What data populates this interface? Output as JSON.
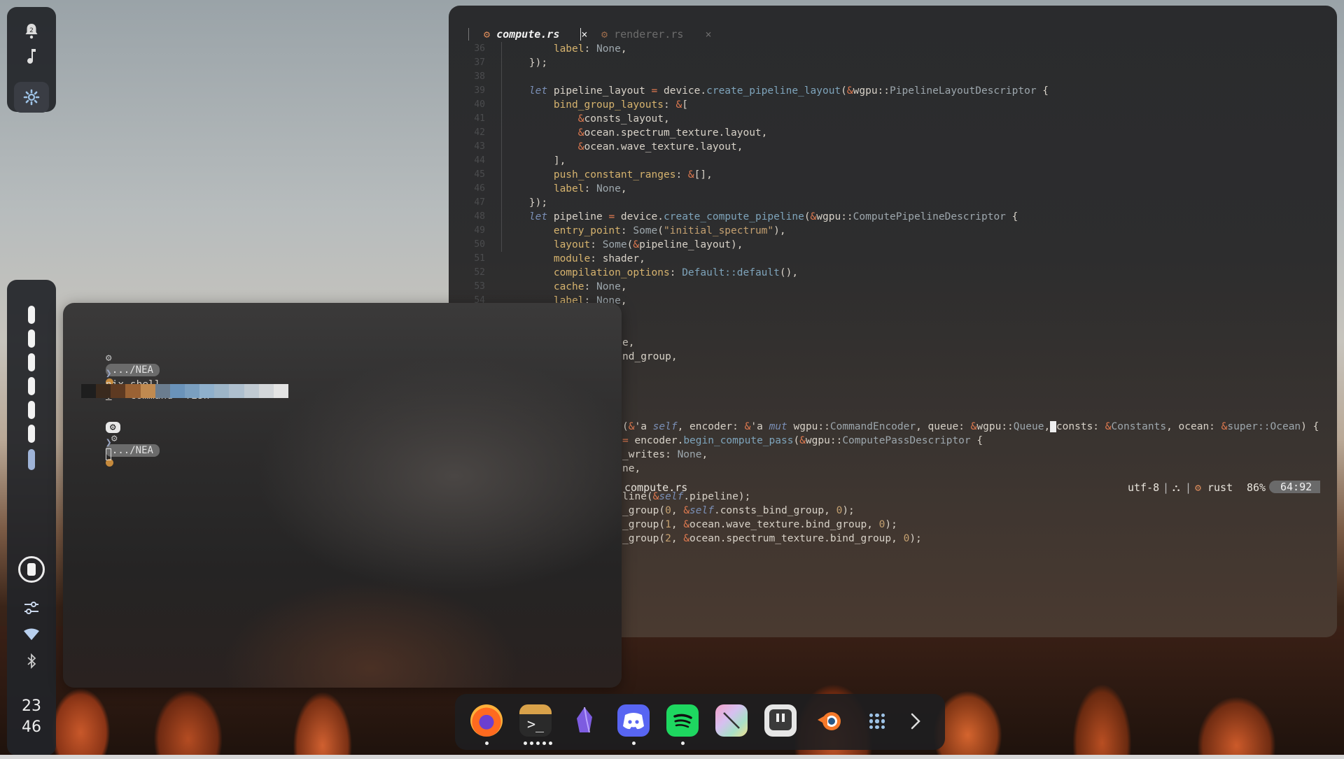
{
  "sidebar": {
    "notification_count": "2",
    "clock_hour": "23",
    "clock_minute": "46"
  },
  "editor": {
    "tabs": [
      {
        "label": "compute.rs",
        "active": true
      },
      {
        "label": "renderer.rs",
        "active": false
      }
    ],
    "close_glyph": "×",
    "lines": [
      {
        "n": "36",
        "html": "        <span class='pr'>label</span>: <span class='ty'>None</span>,"
      },
      {
        "n": "37",
        "html": "    });"
      },
      {
        "n": "38",
        "html": ""
      },
      {
        "n": "39",
        "html": "    <span class='kw'>let</span> pipeline_layout <span class='op'>=</span> device.<span class='fn'>create_pipeline_layout</span>(<span class='op'>&amp;</span>wgpu::<span class='ty'>PipelineLayoutDescriptor</span> {"
      },
      {
        "n": "40",
        "html": "        <span class='pr'>bind_group_layouts</span>: <span class='op'>&amp;</span>["
      },
      {
        "n": "41",
        "html": "            <span class='op'>&amp;</span>consts_layout,"
      },
      {
        "n": "42",
        "html": "            <span class='op'>&amp;</span>ocean.spectrum_texture.layout,"
      },
      {
        "n": "43",
        "html": "            <span class='op'>&amp;</span>ocean.wave_texture.layout,"
      },
      {
        "n": "44",
        "html": "        ],"
      },
      {
        "n": "45",
        "html": "        <span class='pr'>push_constant_ranges</span>: <span class='op'>&amp;</span>[],"
      },
      {
        "n": "46",
        "html": "        <span class='pr'>label</span>: <span class='ty'>None</span>,"
      },
      {
        "n": "47",
        "html": "    });"
      },
      {
        "n": "48",
        "html": "    <span class='kw'>let</span> pipeline <span class='op'>=</span> device.<span class='fn'>create_compute_pipeline</span>(<span class='op'>&amp;</span>wgpu::<span class='ty'>ComputePipelineDescriptor</span> {"
      },
      {
        "n": "49",
        "html": "        <span class='pr'>entry_point</span>: <span class='ty'>Some</span>(<span class='st'>\"initial_spectrum\"</span>),"
      },
      {
        "n": "50",
        "html": "        <span class='pr'>layout</span>: <span class='ty'>Some</span>(<span class='op'>&amp;</span>pipeline_layout),"
      },
      {
        "n": "51",
        "html": "        <span class='pr'>module</span>: shader,"
      },
      {
        "n": "52",
        "html": "        <span class='pr'>compilation_options</span>: <span class='fn'>Default::default</span>(),"
      },
      {
        "n": "53",
        "html": "        <span class='pr'>cache</span>: <span class='ty'>None</span>,"
      },
      {
        "n": "54",
        "html": "        <span class='pr'>label</span>: <span class='ty'>None</span>,"
      }
    ],
    "partial_lines": [
      {
        "row": 22,
        "html": "e,"
      },
      {
        "row": 23,
        "html": "nd_group,"
      },
      {
        "row": 28,
        "html": "(<span class='op'>&amp;</span>'a <span class='kw'>self</span>, encoder: <span class='op'>&amp;</span>'a <span class='kw'>mut</span> wgpu::<span class='ty'>CommandEncoder</span>, queue: <span class='op'>&amp;</span>wgpu::<span class='ty'>Queue</span>,<span style='background:#eee;color:#222'> </span>consts: <span class='op'>&amp;</span><span class='ty'>Constants</span>, ocean: <span class='op'>&amp;</span><span class='ty'>super::Ocean</span>) {"
      },
      {
        "row": 29,
        "html": "<span class='op'>=</span> encoder.<span class='fn'>begin_compute_pass</span>(<span class='op'>&amp;</span>wgpu::<span class='ty'>ComputePassDescriptor</span> {"
      },
      {
        "row": 30,
        "html": "_writes: <span class='ty'>None</span>,"
      },
      {
        "row": 31,
        "html": "ne,"
      },
      {
        "row": 33,
        "html": "line(<span class='op'>&amp;</span><span class='kw'>self</span>.pipeline);"
      },
      {
        "row": 34,
        "html": "_group(<span class='nu'>0</span>, <span class='op'>&amp;</span><span class='kw'>self</span>.consts_bind_group, <span class='nu'>0</span>);"
      },
      {
        "row": 35,
        "html": "_group(<span class='nu'>1</span>, <span class='op'>&amp;</span>ocean.wave_texture.bind_group, <span class='nu'>0</span>);"
      },
      {
        "row": 36,
        "html": "_group(<span class='nu'>2</span>, <span class='op'>&amp;</span>ocean.spectrum_texture.bind_group, <span class='nu'>0</span>);"
      }
    ],
    "status": {
      "filename": "compute.rs",
      "encoding": "utf-8",
      "separator": "|",
      "os_icon": "linux-icon",
      "language": "rust",
      "percent": "86%",
      "position": "64:92"
    }
  },
  "terminal": {
    "path_badge": ".../NEA",
    "prompt_glyph": "❯",
    "command_name": "nix-shell",
    "command_dot": ".",
    "command_args": " --command \"fish\"",
    "palette": [
      "#1e1e1e",
      "#3a2a1e",
      "#5e3a22",
      "#9a6234",
      "#c08a50",
      "#6b7d8f",
      "#6a93ba",
      "#7a9fc0",
      "#8fb0cc",
      "#9db5c8",
      "#aebfce",
      "#c0cad2",
      "#d2d6d9",
      "#e4e4e4"
    ],
    "second_path_badge": ".../NEA"
  },
  "dock": {
    "apps": [
      {
        "name": "firefox-icon",
        "running": 1
      },
      {
        "name": "terminal-icon",
        "running": 5
      },
      {
        "name": "obsidian-icon",
        "running": 0
      },
      {
        "name": "discord-icon",
        "running": 1
      },
      {
        "name": "spotify-icon",
        "running": 1
      },
      {
        "name": "paint-icon",
        "running": 0
      },
      {
        "name": "pause-app-icon",
        "running": 0
      },
      {
        "name": "blender-icon",
        "running": 0
      }
    ],
    "grid_icon": "app-grid-icon",
    "next_icon": "chevron-right-icon"
  },
  "colors": {
    "accent": "#c68a3c",
    "editor_bg": "#2d2d2e",
    "terminal_bg": "#2c2b2b",
    "status_badge": "#6a6a6a"
  }
}
